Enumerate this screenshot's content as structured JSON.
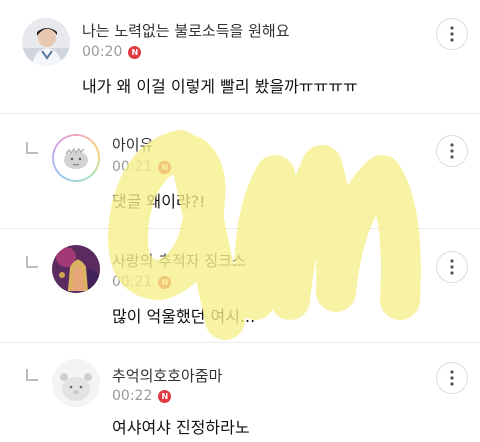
{
  "comments": [
    {
      "author": "나는 노력없는 불로소득을 원해요",
      "time": "00:20",
      "new_badge": "N",
      "text": "내가 왜 이걸 이렇게 빨리 봤을까ㅠㅠㅠㅠ",
      "reply": false
    },
    {
      "author": "아이유",
      "time": "00:21",
      "new_badge": "N",
      "text": "댓글 왜이랴?!",
      "reply": true
    },
    {
      "author": "사랑의 추적자 징크스",
      "time": "00:21",
      "new_badge": "N",
      "text": "많이 억울했던 여시...",
      "reply": true
    },
    {
      "author": "추억의호호아줌마",
      "time": "00:22",
      "new_badge": "N",
      "text": "여샤여샤 진정하라노",
      "reply": true
    }
  ],
  "more_icon": "more-vertical-icon",
  "reply_icon": "reply-arrow-icon",
  "colors": {
    "new_badge": "#e0383e",
    "watermark": "#f6f08a"
  }
}
